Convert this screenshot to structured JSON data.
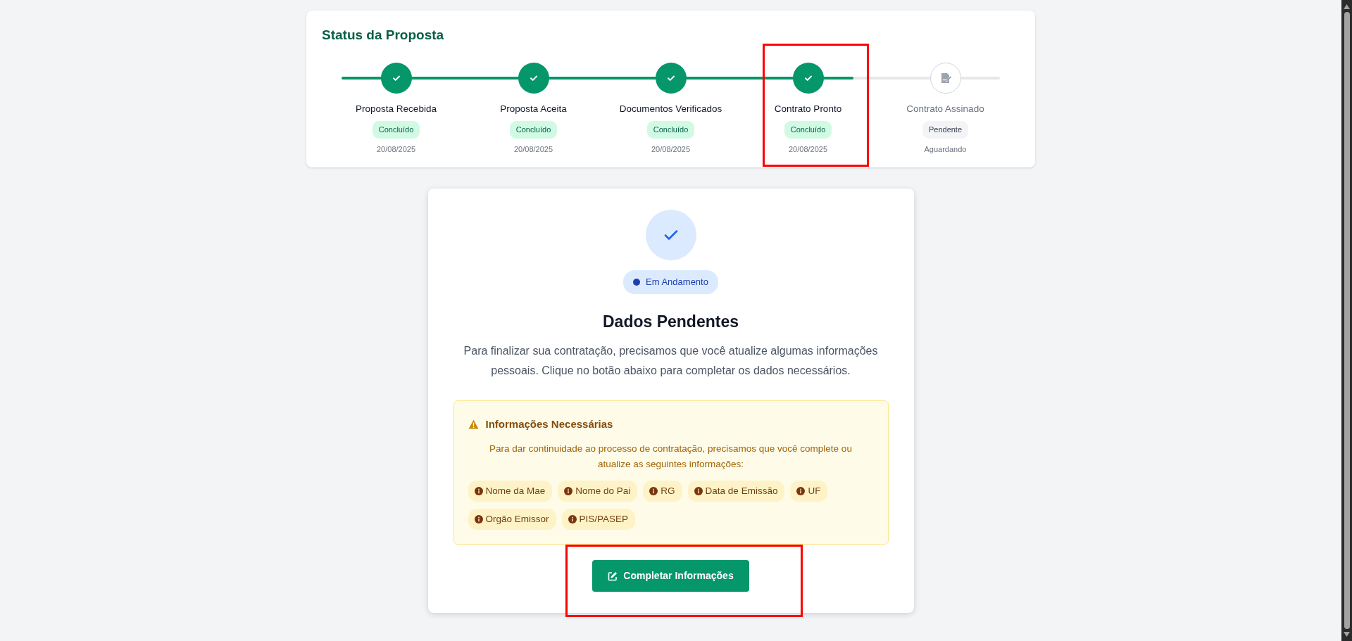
{
  "status_card": {
    "title": "Status da Proposta",
    "annotation": {
      "kind": "frame_current_step"
    },
    "steps": [
      {
        "name": "Proposta Recebida",
        "kind": "done",
        "badge": "Concluído",
        "date": "20/08/2025"
      },
      {
        "name": "Proposta Aceita",
        "kind": "done",
        "badge": "Concluído",
        "date": "20/08/2025"
      },
      {
        "name": "Documentos Verificados",
        "kind": "done",
        "badge": "Concluído",
        "date": "20/08/2025"
      },
      {
        "name": "Contrato Pronto",
        "kind": "done",
        "badge": "Concluído",
        "date": "20/08/2025"
      },
      {
        "name": "Contrato Assinado",
        "kind": "pending",
        "badge": "Pendente",
        "date": "Aguardando"
      }
    ]
  },
  "pending_card": {
    "status": {
      "label": "Em Andamento",
      "color": "#1e40af"
    },
    "heading": "Dados Pendentes",
    "text": "Para finalizar sua contratação, precisamos que você atualize algumas informações pessoais. Clique no botão abaixo para completar os dados necessários.",
    "notice": {
      "title": "Informações Necessárias",
      "text": "Para dar continuidade ao processo de contratação, precisamos que você complete ou atualize as seguintes informações:",
      "fields": [
        "Nome da Mae",
        "Nome do Pai",
        "RG",
        "Data de Emissão",
        "UF",
        "Orgão Emissor",
        "PIS/PASEP"
      ]
    },
    "action_button": {
      "label": "Completar Informações"
    },
    "annotation": {
      "kind": "frame_action_button"
    }
  }
}
